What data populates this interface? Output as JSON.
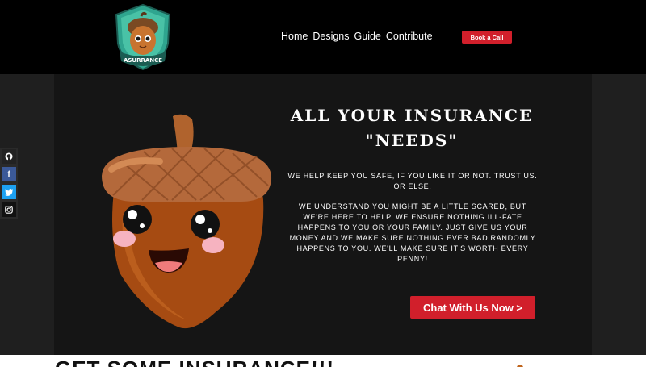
{
  "header": {
    "logo_text": "ASURRANCE",
    "nav": [
      "Home",
      "Designs",
      "Guide",
      "Contribute"
    ],
    "book_label": "Book a Call"
  },
  "hero": {
    "headline_line1": "ALL YOUR INSURANCE",
    "headline_line2": "\"NEEDS\"",
    "para1": "WE HELP KEEP YOU SAFE, IF YOU LIKE IT OR NOT. TRUST US. OR ELSE.",
    "para2": "WE UNDERSTAND YOU MIGHT BE A LITTLE SCARED, BUT WE'RE HERE TO HELP. WE ENSURE NOTHING ILL-FATE HAPPENS TO YOU OR YOUR FAMILY. JUST GIVE US YOUR MONEY AND WE MAKE SURE NOTHING EVER BAD RANDOMLY HAPPENS TO YOU. WE'LL MAKE SURE IT'S WORTH EVERY PENNY!",
    "cta_label": "Chat With Us Now >"
  },
  "social": [
    "github-icon",
    "facebook-icon",
    "twitter-icon",
    "instagram-icon"
  ],
  "lower": {
    "title": "GET SOME INSURANCE!!!"
  },
  "colors": {
    "accent": "#d11f2b",
    "acorn_body": "#a94a12",
    "acorn_cap": "#b4693b"
  }
}
